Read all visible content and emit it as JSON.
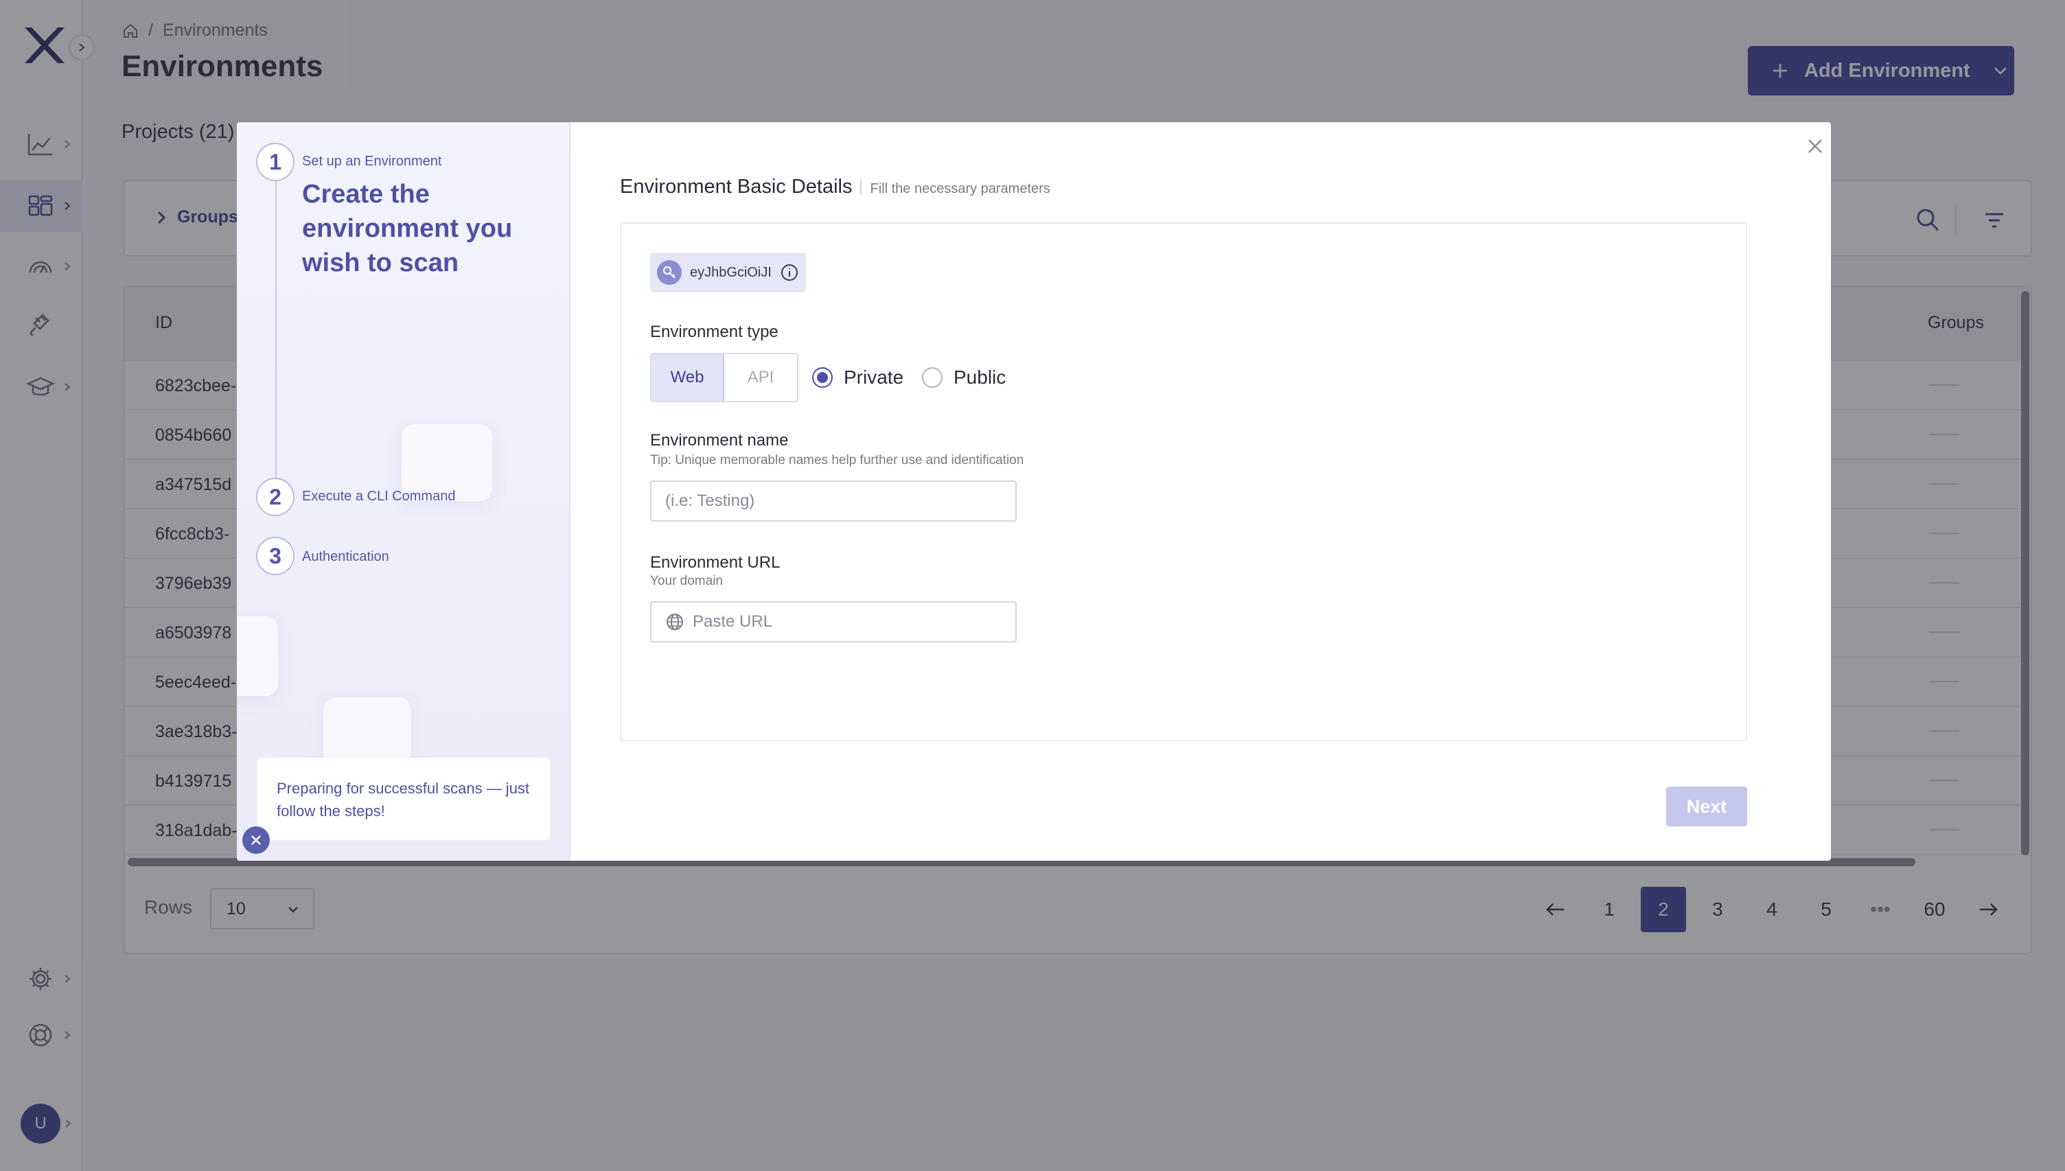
{
  "breadcrumb": {
    "current": "Environments"
  },
  "page": {
    "title": "Environments",
    "projects_label": "Projects (21)"
  },
  "header": {
    "add_button_label": "Add Environment"
  },
  "filters": {
    "groups_label": "Groups"
  },
  "table": {
    "columns": {
      "id": "ID",
      "groups": "Groups"
    },
    "rows": [
      "6823cbee-",
      "0854b660",
      "a347515d",
      "6fcc8cb3-",
      "3796eb39",
      "a6503978",
      "5eec4eed-",
      "3ae318b3-",
      "b4139715",
      "318a1dab-"
    ],
    "rows_label": "Rows",
    "rows_per_page": "10"
  },
  "pagination": {
    "pages": [
      "1",
      "2",
      "3",
      "4",
      "5"
    ],
    "current": "2",
    "ellipsis": "•••",
    "last": "60"
  },
  "sidebar": {
    "items": [
      {
        "icon": "chart-line-icon"
      },
      {
        "icon": "dashboard-icon",
        "active": true
      },
      {
        "icon": "scan-gauge-icon"
      },
      {
        "icon": "plug-icon"
      },
      {
        "icon": "graduation-cap-icon"
      }
    ],
    "bottom": [
      {
        "icon": "gear-icon"
      },
      {
        "icon": "lifebuoy-icon"
      }
    ],
    "avatar_initial": "U"
  },
  "wizard": {
    "steps": [
      {
        "number": "1",
        "label": "Set up an Environment",
        "heading": "Create the environment you wish to scan"
      },
      {
        "number": "2",
        "label": "Execute a CLI Command"
      },
      {
        "number": "3",
        "label": "Authentication"
      }
    ],
    "tip": "Preparing for successful scans — just follow the steps!"
  },
  "form": {
    "section_title": "Environment Basic Details",
    "section_subtitle": "Fill the necessary parameters",
    "token": "eyJhbGciOiJI",
    "env_type_label": "Environment type",
    "type_options": [
      "Web",
      "API"
    ],
    "selected_type": "Web",
    "visibility_options": [
      "Private",
      "Public"
    ],
    "selected_visibility": "Private",
    "name_label": "Environment name",
    "name_hint": "Tip: Unique memorable names help further use and identification",
    "name_placeholder": "(i.e: Testing)",
    "url_label": "Environment URL",
    "url_hint": "Your domain",
    "url_placeholder": "Paste URL",
    "next_label": "Next"
  },
  "colors": {
    "accent": "#3a3f96",
    "wizard_text": "#4d51a3",
    "overlay": "rgba(45,45,55,0.5)",
    "next_disabled": "#c5c7ec"
  }
}
